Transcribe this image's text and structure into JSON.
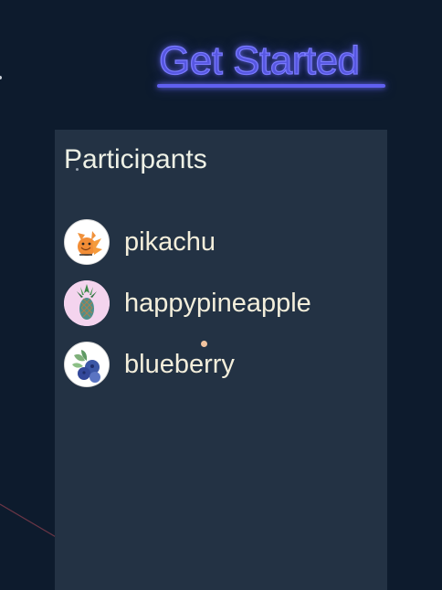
{
  "header": {
    "cta_label": "Get Started"
  },
  "participants_panel": {
    "title": "Participants",
    "items": [
      {
        "name": "pikachu",
        "avatar_icon": "pikachu-avatar-icon"
      },
      {
        "name": "happypineapple",
        "avatar_icon": "pineapple-avatar-icon"
      },
      {
        "name": "blueberry",
        "avatar_icon": "blueberry-avatar-icon"
      }
    ]
  },
  "colors": {
    "background": "#0d1b2d",
    "panel": "#233244",
    "cta_neon": "#6060f0",
    "text": "#f3eedb"
  }
}
